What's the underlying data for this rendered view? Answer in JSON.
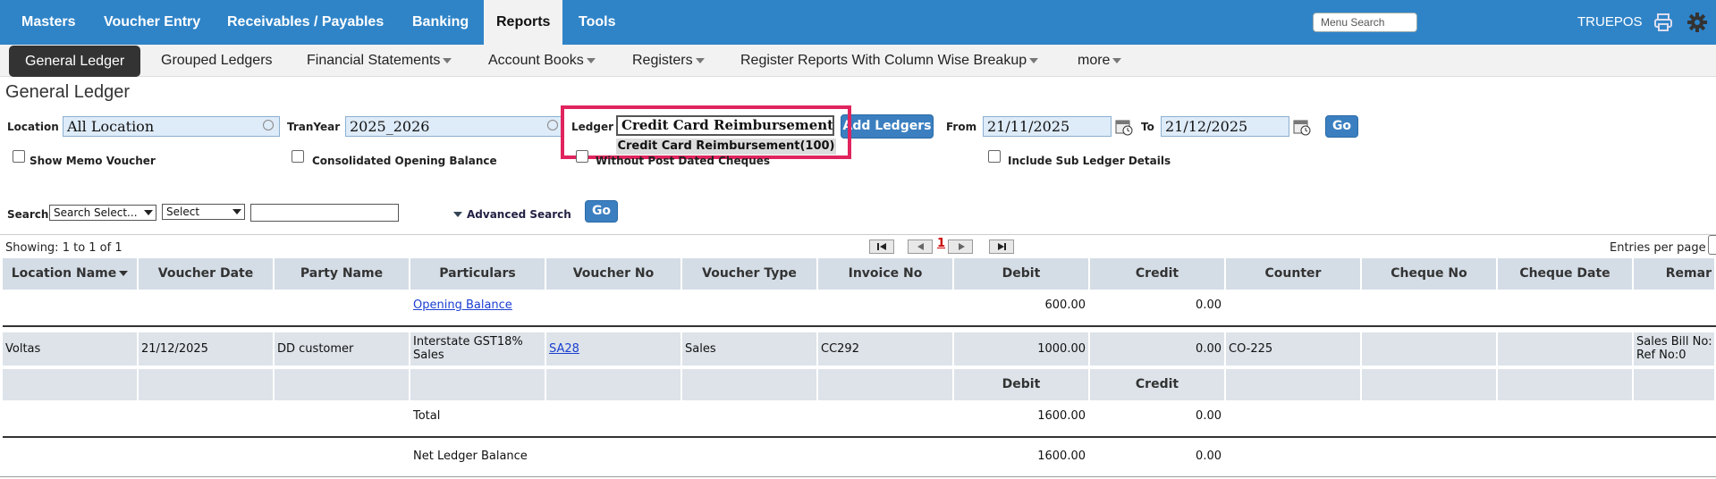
{
  "topnav": {
    "items": [
      {
        "label": "Masters"
      },
      {
        "label": "Voucher Entry"
      },
      {
        "label": "Receivables / Payables"
      },
      {
        "label": "Banking"
      },
      {
        "label": "Reports"
      },
      {
        "label": "Tools"
      }
    ],
    "active": "Reports",
    "menu_search_placeholder": "Menu Search",
    "company": "TRUEPOS",
    "icons": [
      "printer-icon",
      "gear-icon"
    ]
  },
  "subnav": {
    "items": [
      {
        "label": "General Ledger"
      },
      {
        "label": "Grouped Ledgers"
      },
      {
        "label": "Financial Statements"
      },
      {
        "label": "Account Books"
      },
      {
        "label": "Registers"
      },
      {
        "label": "Register Reports With Column Wise Breakup"
      },
      {
        "label": "more"
      }
    ],
    "active": "General Ledger"
  },
  "panel": {
    "title": "General Ledger",
    "location_label": "Location",
    "location_value": "All Location",
    "tranyear_label": "TranYear",
    "tranyear_value": "2025_2026",
    "ledger_label": "Ledger",
    "ledger_value": "Credit Card Reimbursement(",
    "ledger_suggestion": "Credit Card Reimbursement(100)",
    "add_ledgers": "Add Ledgers",
    "from_label": "From",
    "from_value": "21/11/2025",
    "to_label": "To",
    "to_value": "21/12/2025",
    "go": "Go",
    "show_memo": "Show Memo Voucher",
    "consolidated": "Consolidated Opening Balance",
    "without_pdc": "Without Post Dated Cheques",
    "include_sub": "Include Sub Ledger Details",
    "search_label": "Search",
    "search_select": "Search Select...",
    "select": "Select",
    "advanced_search": "Advanced Search",
    "search_go": "Go"
  },
  "pager": {
    "showing": "Showing: 1 to 1 of 1",
    "page": "1",
    "entries_per_page": "Entries per page"
  },
  "table": {
    "headers": [
      "Location Name",
      "Voucher Date",
      "Party Name",
      "Particulars",
      "Voucher No",
      "Voucher Type",
      "Invoice No",
      "Debit",
      "Credit",
      "Counter",
      "Cheque No",
      "Cheque Date",
      "Remar"
    ],
    "opening": {
      "particulars": "Opening Balance",
      "debit": "600.00",
      "credit": "0.00"
    },
    "rows": [
      {
        "location": "Voltas",
        "date": "21/12/2025",
        "party": "DD customer",
        "particulars_1": "Interstate GST18%",
        "particulars_2": "Sales",
        "voucher_no": "SA28",
        "voucher_type": "Sales",
        "invoice_no": "CC292",
        "debit": "1000.00",
        "credit": "0.00",
        "counter": "CO-225",
        "cheque_no": "",
        "cheque_date": "",
        "remarks_1": "Sales Bill No:",
        "remarks_2": "Ref No:0"
      }
    ],
    "summary_headers": {
      "debit": "Debit",
      "credit": "Credit"
    },
    "total": {
      "label": "Total",
      "debit": "1600.00",
      "credit": "0.00"
    },
    "net": {
      "label": "Net Ledger Balance",
      "debit": "1600.00",
      "credit": "0.00"
    }
  }
}
